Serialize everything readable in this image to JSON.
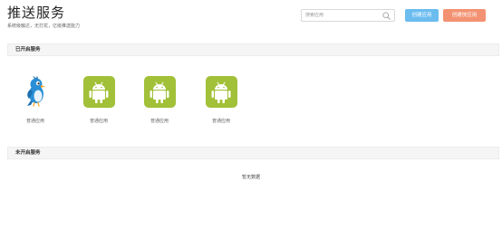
{
  "header": {
    "title": "推送服务",
    "subtitle": "系统级触达，无打扰，亿级推送能力"
  },
  "search": {
    "placeholder": "搜索应用"
  },
  "toolbar": {
    "create_app_label": "创建应用",
    "create_quick_app_label": "创建快应用"
  },
  "sections": {
    "enabled": {
      "title": "已开启服务",
      "apps": [
        {
          "name": "普通应用",
          "icon": "bird-icon"
        },
        {
          "name": "普通应用",
          "icon": "android-icon"
        },
        {
          "name": "普通应用",
          "icon": "android-icon"
        },
        {
          "name": "普通应用",
          "icon": "android-icon"
        }
      ]
    },
    "disabled": {
      "title": "未开启服务",
      "empty_text": "暂无数据"
    }
  },
  "colors": {
    "create_app_button": "#6bbcef",
    "create_quick_app_button": "#f39272",
    "android_tile": "#a2c038"
  }
}
